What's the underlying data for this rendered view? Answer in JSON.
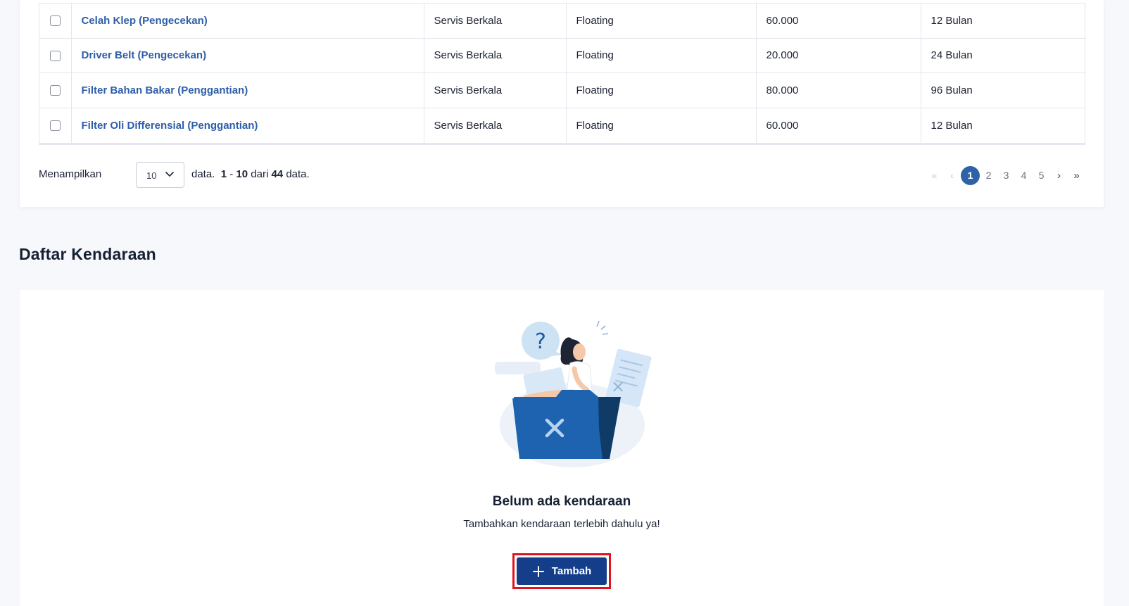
{
  "maintenance_table": {
    "rows": [
      {
        "name": "Celah Klep (Pengecekan)",
        "category": "Servis Berkala",
        "type": "Floating",
        "distance": "60.000",
        "interval": "12 Bulan"
      },
      {
        "name": "Driver Belt (Pengecekan)",
        "category": "Servis Berkala",
        "type": "Floating",
        "distance": "20.000",
        "interval": "24 Bulan"
      },
      {
        "name": "Filter Bahan Bakar (Penggantian)",
        "category": "Servis Berkala",
        "type": "Floating",
        "distance": "80.000",
        "interval": "96 Bulan"
      },
      {
        "name": "Filter Oli Differensial (Penggantian)",
        "category": "Servis Berkala",
        "type": "Floating",
        "distance": "60.000",
        "interval": "12 Bulan"
      }
    ]
  },
  "pager": {
    "show_label": "Menampilkan",
    "page_size": "10",
    "data_word": "data.",
    "range_start": "1",
    "range_sep": "-",
    "range_end": "10",
    "of_word": "dari",
    "total": "44",
    "data_word_end": "data.",
    "first": "«",
    "prev": "‹",
    "pages": [
      "1",
      "2",
      "3",
      "4",
      "5"
    ],
    "current_page": "1",
    "next": "›",
    "last": "»"
  },
  "vehicles_section": {
    "title": "Daftar Kendaraan",
    "empty_title": "Belum ada kendaraan",
    "empty_subtitle": "Tambahkan kendaraan terlebih dahulu ya!",
    "add_button_label": "Tambah",
    "add_icon": "plus-icon"
  },
  "colors": {
    "link": "#2e5ea8",
    "primary": "#153e8a",
    "active_page": "#2d63a6",
    "highlight_outline": "#e0141f"
  }
}
